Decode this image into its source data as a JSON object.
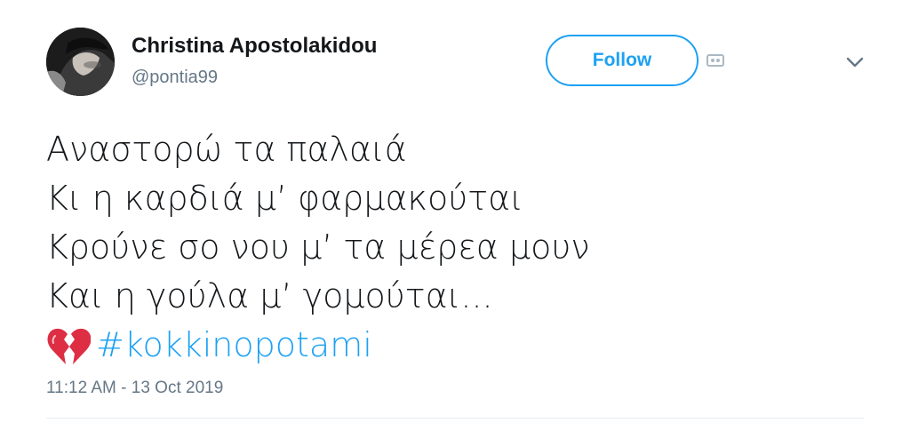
{
  "author": {
    "name": "Christina Apostolakidou",
    "handle": "@pontia99"
  },
  "follow_button": {
    "label": "Follow"
  },
  "icons": {
    "ticket": "ticket-icon",
    "chevron": "chevron-down-icon",
    "emoji": "broken-heart-icon"
  },
  "tweet": {
    "lines": [
      "Αναστορώ τα παλαιά",
      "Κι η καρδιά μ’ φαρμακούται",
      "Κρούνε σο νου μ’ τα μέρεα μουν",
      "Και η γούλα μ’ γομούται..."
    ],
    "hashtag": "#kokkinopotami"
  },
  "timestamp": "11:12 AM - 13 Oct 2019",
  "colors": {
    "accent": "#1da1f2",
    "secondary_text": "#657786",
    "primary_text": "#14171a",
    "broken_heart": "#dd2e44"
  }
}
